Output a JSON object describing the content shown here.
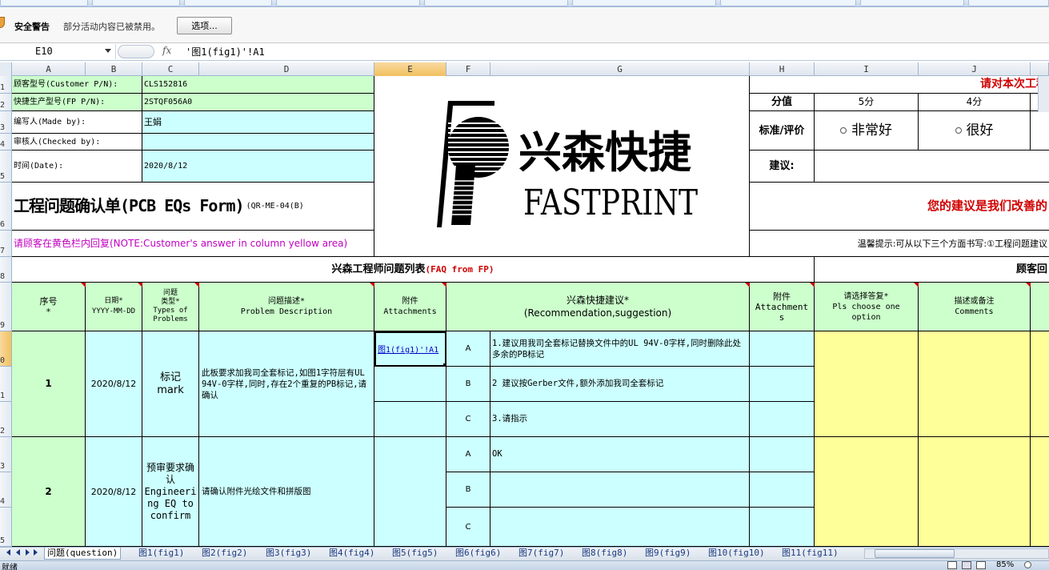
{
  "security_bar": {
    "title": "安全警告",
    "message": "部分活动内容已被禁用。",
    "options_button": "选项..."
  },
  "formula_bar": {
    "name_box": "E10",
    "fx_label": "fx",
    "formula": "'图1(fig1)'!A1"
  },
  "columns": [
    "A",
    "B",
    "C",
    "D",
    "E",
    "F",
    "G",
    "H",
    "I",
    "J"
  ],
  "rows": [
    "1",
    "2",
    "3",
    "4",
    "5",
    "6",
    "7",
    "8",
    "9",
    "0",
    "1",
    "2",
    "3",
    "4",
    "5"
  ],
  "header_info": {
    "customer_pn_label": "顾客型号(Customer P/N):",
    "customer_pn_value": "CLS152816",
    "fp_pn_label": "快捷生产型号(FP P/N):",
    "fp_pn_value": "2STQF056A0",
    "made_by_label": "编写人(Made by):",
    "made_by_value": "王娟",
    "checked_by_label": "审核人(Checked by):",
    "checked_by_value": "",
    "date_label": "时间(Date):",
    "date_value": "2020/8/12"
  },
  "form_title": {
    "main": "工程问题确认单(PCB EQs Form)",
    "code": "(QR-ME-04(B)"
  },
  "note": "请顾客在黄色栏内回复(NOTE:Customer's answer in column yellow area)",
  "logo": {
    "chinese": "兴森快捷",
    "english": "FASTPRINT"
  },
  "rating": {
    "title": "请对本次工程",
    "score_label": "分值",
    "score_5": "5分",
    "score_4": "4分",
    "std_label": "标准/评价",
    "opt_very_good": "非常好",
    "opt_good": "很好",
    "suggest_label": "建议:",
    "improve_msg": "您的建议是我们改善的",
    "tip": "温馨提示:可从以下三个方面书写:①工程问题建议"
  },
  "faq_section": {
    "fp_title": "兴森工程师问题列表",
    "fp_title_en": "(FAQ from FP)",
    "customer_title": "顾客回"
  },
  "table_headers": {
    "seq": "序号\n*",
    "date": "日期*\nYYYY-MM-DD",
    "type": "问题\n类型*\nTypes of\nProblems",
    "desc": "问题描述*\nProblem Description",
    "attach": "附件\nAttachments",
    "suggest": "兴森快捷建议*\n(Recommendation,suggestion)",
    "attach2": "附件\nAttachment\ns",
    "choose": "请选择答复*\nPls choose one option",
    "comments": "描述或备注\nComments"
  },
  "problems": [
    {
      "seq": "1",
      "date": "2020/8/12",
      "type": "标记\nmark",
      "desc": "此板要求加我司全套标记,如图1字符层有UL 94V-0字样,同时,存在2个重复的PB标记,请确认",
      "attach_link": "图1(fig1)'!A1",
      "options": [
        {
          "key": "A",
          "text": "1.建议用我司全套标记替换文件中的UL 94V-0字样,同时删除此处多余的PB标记"
        },
        {
          "key": "B",
          "text": "2 建议按Gerber文件,额外添加我司全套标记"
        },
        {
          "key": "C",
          "text": "3.请指示"
        }
      ]
    },
    {
      "seq": "2",
      "date": "2020/8/12",
      "type": "预审要求确认\nEngineering EQ to confirm",
      "desc": "请确认附件光绘文件和拼版图",
      "options": [
        {
          "key": "A",
          "text": "OK"
        },
        {
          "key": "B",
          "text": ""
        },
        {
          "key": "C",
          "text": ""
        }
      ]
    }
  ],
  "sheet_tabs": [
    "问题(question)",
    "图1(fig1)",
    "图2(fig2)",
    "图3(fig3)",
    "图4(fig4)",
    "图5(fig5)",
    "图6(fig6)",
    "图7(fig7)",
    "图8(fig8)",
    "图9(fig9)",
    "图10(fig10)",
    "图11(fig11)"
  ],
  "status": {
    "ready": "就绪",
    "zoom": "85%"
  }
}
